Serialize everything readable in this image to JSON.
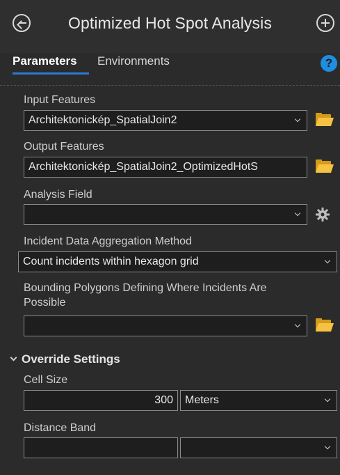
{
  "header": {
    "title": "Optimized Hot Spot Analysis",
    "back_icon": "back-arrow-circle-icon",
    "add_icon": "plus-circle-icon"
  },
  "tabs": {
    "parameters": "Parameters",
    "environments": "Environments",
    "help_icon": "?"
  },
  "params": {
    "input_features": {
      "label": "Input Features",
      "value": "Architektonickép_SpatialJoin2"
    },
    "output_features": {
      "label": "Output Features",
      "value": "Architektonickép_SpatialJoin2_OptimizedHotS"
    },
    "analysis_field": {
      "label": "Analysis Field",
      "value": ""
    },
    "aggregation_method": {
      "label": "Incident Data Aggregation Method",
      "value": "Count incidents within hexagon grid"
    },
    "bounding_polygons": {
      "label_line1": "Bounding Polygons Defining Where Incidents Are",
      "label_line2": "Possible",
      "value": ""
    }
  },
  "override": {
    "title": "Override Settings",
    "cell_size": {
      "label": "Cell Size",
      "value": "300",
      "unit": "Meters"
    },
    "distance_band": {
      "label": "Distance Band",
      "value": "",
      "unit": ""
    }
  },
  "colors": {
    "background": "#2b2b2b",
    "accent": "#2a7bd3",
    "help": "#1e8ee0",
    "folder": "#f6c244"
  }
}
